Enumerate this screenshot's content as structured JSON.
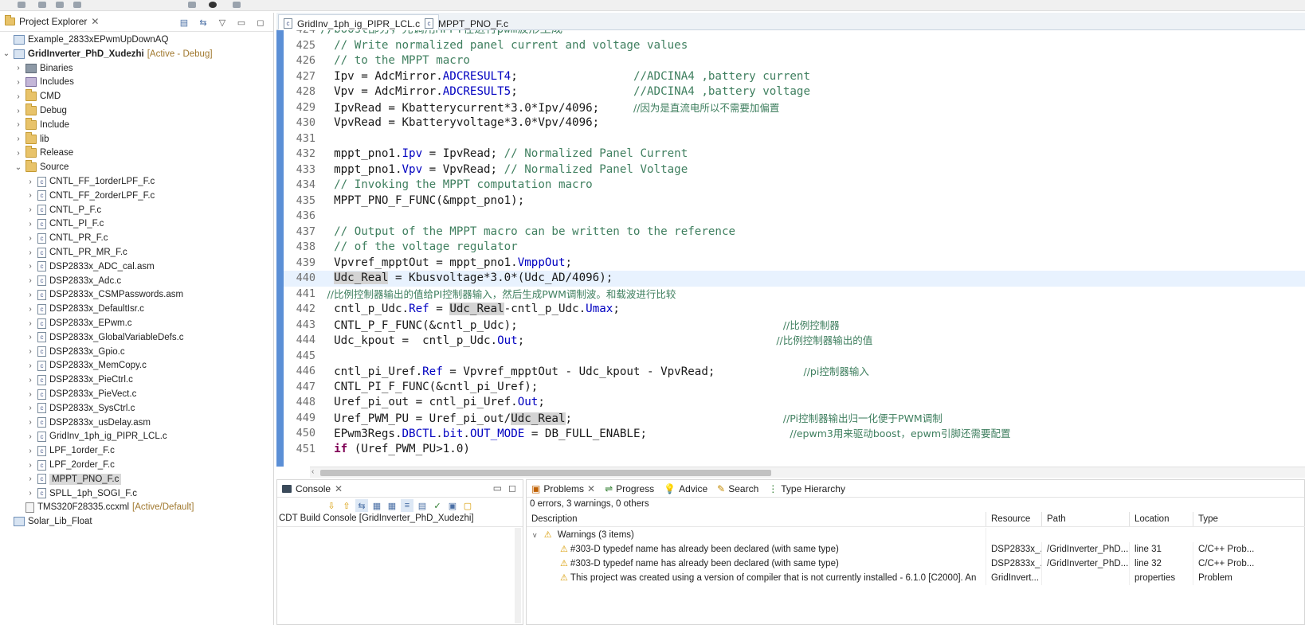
{
  "project_explorer": {
    "tab_label": "Project Explorer",
    "items": [
      {
        "label": "Example_2833xEPwmUpDownAQ",
        "type": "proj",
        "twisty": "",
        "indent": 0
      },
      {
        "label": "GridInverter_PhD_Xudezhi",
        "type": "proj",
        "twisty": "v",
        "indent": 0,
        "bold": true,
        "decoration": "[Active - Debug]"
      },
      {
        "label": "Binaries",
        "type": "bin",
        "twisty": ">",
        "indent": 1
      },
      {
        "label": "Includes",
        "type": "inc",
        "twisty": ">",
        "indent": 1
      },
      {
        "label": "CMD",
        "type": "folder",
        "twisty": ">",
        "indent": 1
      },
      {
        "label": "Debug",
        "type": "folder",
        "twisty": ">",
        "indent": 1
      },
      {
        "label": "Include",
        "type": "folder",
        "twisty": ">",
        "indent": 1
      },
      {
        "label": "lib",
        "type": "folder",
        "twisty": ">",
        "indent": 1
      },
      {
        "label": "Release",
        "type": "folder",
        "twisty": ">",
        "indent": 1
      },
      {
        "label": "Source",
        "type": "folder",
        "twisty": "v",
        "indent": 1
      },
      {
        "label": "CNTL_FF_1orderLPF_F.c",
        "type": "cfile",
        "twisty": ">",
        "indent": 2
      },
      {
        "label": "CNTL_FF_2orderLPF_F.c",
        "type": "cfile",
        "twisty": ">",
        "indent": 2
      },
      {
        "label": "CNTL_P_F.c",
        "type": "cfile",
        "twisty": ">",
        "indent": 2
      },
      {
        "label": "CNTL_PI_F.c",
        "type": "cfile",
        "twisty": ">",
        "indent": 2
      },
      {
        "label": "CNTL_PR_F.c",
        "type": "cfile",
        "twisty": ">",
        "indent": 2
      },
      {
        "label": "CNTL_PR_MR_F.c",
        "type": "cfile",
        "twisty": ">",
        "indent": 2
      },
      {
        "label": "DSP2833x_ADC_cal.asm",
        "type": "cfile",
        "twisty": ">",
        "indent": 2
      },
      {
        "label": "DSP2833x_Adc.c",
        "type": "cfile",
        "twisty": ">",
        "indent": 2
      },
      {
        "label": "DSP2833x_CSMPasswords.asm",
        "type": "cfile",
        "twisty": ">",
        "indent": 2
      },
      {
        "label": "DSP2833x_DefaultIsr.c",
        "type": "cfile",
        "twisty": ">",
        "indent": 2
      },
      {
        "label": "DSP2833x_EPwm.c",
        "type": "cfile",
        "twisty": ">",
        "indent": 2
      },
      {
        "label": "DSP2833x_GlobalVariableDefs.c",
        "type": "cfile",
        "twisty": ">",
        "indent": 2
      },
      {
        "label": "DSP2833x_Gpio.c",
        "type": "cfile",
        "twisty": ">",
        "indent": 2
      },
      {
        "label": "DSP2833x_MemCopy.c",
        "type": "cfile",
        "twisty": ">",
        "indent": 2
      },
      {
        "label": "DSP2833x_PieCtrl.c",
        "type": "cfile",
        "twisty": ">",
        "indent": 2
      },
      {
        "label": "DSP2833x_PieVect.c",
        "type": "cfile",
        "twisty": ">",
        "indent": 2
      },
      {
        "label": "DSP2833x_SysCtrl.c",
        "type": "cfile",
        "twisty": ">",
        "indent": 2
      },
      {
        "label": "DSP2833x_usDelay.asm",
        "type": "cfile",
        "twisty": ">",
        "indent": 2
      },
      {
        "label": "GridInv_1ph_ig_PIPR_LCL.c",
        "type": "cfile",
        "twisty": ">",
        "indent": 2
      },
      {
        "label": "LPF_1order_F.c",
        "type": "cfile",
        "twisty": ">",
        "indent": 2
      },
      {
        "label": "LPF_2order_F.c",
        "type": "cfile",
        "twisty": ">",
        "indent": 2
      },
      {
        "label": "MPPT_PNO_F.c",
        "type": "cfile",
        "twisty": ">",
        "indent": 2,
        "selected": true
      },
      {
        "label": "SPLL_1ph_SOGI_F.c",
        "type": "cfile",
        "twisty": ">",
        "indent": 2
      },
      {
        "label": "TMS320F28335.ccxml",
        "type": "xml",
        "twisty": "",
        "indent": 1,
        "decoration": "[Active/Default]"
      },
      {
        "label": "Solar_Lib_Float",
        "type": "proj",
        "twisty": "",
        "indent": 0
      }
    ]
  },
  "editor": {
    "tabs": [
      {
        "label": "GridInv_1ph_ig_PIPR_LCL.c",
        "active": true
      },
      {
        "label": "MPPT_PNO_F.c",
        "active": false
      }
    ],
    "lines": [
      {
        "n": "424",
        "segs": [
          [
            "cm",
            "//boost部分，先调用MPPT在进行pwm波形生成"
          ]
        ],
        "indent": "",
        "partial": true
      },
      {
        "n": "425",
        "segs": [
          [
            "cm",
            "// Write normalized panel current and voltage values"
          ]
        ],
        "indent": "  "
      },
      {
        "n": "426",
        "segs": [
          [
            "cm",
            "// to the MPPT macro"
          ]
        ],
        "indent": "  "
      },
      {
        "n": "427",
        "segs": [
          [
            "",
            "Ipv = AdcMirror."
          ],
          [
            "fld",
            "ADCRESULT4"
          ],
          [
            "",
            ";                 "
          ],
          [
            "cm",
            "//ADCINA4 ,battery current"
          ]
        ],
        "indent": "  "
      },
      {
        "n": "428",
        "segs": [
          [
            "",
            "Vpv = AdcMirror."
          ],
          [
            "fld",
            "ADCRESULT5"
          ],
          [
            "",
            ";                 "
          ],
          [
            "cm",
            "//ADCINA4 ,battery voltage"
          ]
        ],
        "indent": "  "
      },
      {
        "n": "429",
        "segs": [
          [
            "",
            "IpvRead = Kbatterycurrent*3.0*Ipv/4096;     "
          ],
          [
            "cmcn",
            "//因为是直流电所以不需要加偏置"
          ]
        ],
        "indent": "  "
      },
      {
        "n": "430",
        "segs": [
          [
            "",
            "VpvRead = Kbatteryvoltage*3.0*Vpv/4096;"
          ]
        ],
        "indent": "  "
      },
      {
        "n": "431",
        "segs": [],
        "indent": ""
      },
      {
        "n": "432",
        "segs": [
          [
            "",
            "mppt_pno1."
          ],
          [
            "fld",
            "Ipv"
          ],
          [
            "",
            " = IpvRead; "
          ],
          [
            "cm",
            "// Normalized Panel Current"
          ]
        ],
        "indent": "  "
      },
      {
        "n": "433",
        "segs": [
          [
            "",
            "mppt_pno1."
          ],
          [
            "fld",
            "Vpv"
          ],
          [
            "",
            " = VpvRead; "
          ],
          [
            "cm",
            "// Normalized Panel Voltage"
          ]
        ],
        "indent": "  "
      },
      {
        "n": "434",
        "segs": [
          [
            "cm",
            "// Invoking the MPPT computation macro"
          ]
        ],
        "indent": "  "
      },
      {
        "n": "435",
        "segs": [
          [
            "",
            "MPPT_PNO_F_FUNC(&mppt_pno1);"
          ]
        ],
        "indent": "  "
      },
      {
        "n": "436",
        "segs": [],
        "indent": ""
      },
      {
        "n": "437",
        "segs": [
          [
            "cm",
            "// Output of the MPPT macro can be written to the reference"
          ]
        ],
        "indent": "  "
      },
      {
        "n": "438",
        "segs": [
          [
            "cm",
            "// of the voltage regulator"
          ]
        ],
        "indent": "  "
      },
      {
        "n": "439",
        "segs": [
          [
            "",
            "Vpvref_mpptOut = mppt_pno1."
          ],
          [
            "fld",
            "VmppOut"
          ],
          [
            "",
            ";"
          ]
        ],
        "indent": "  "
      },
      {
        "n": "440",
        "segs": [
          [
            "mk",
            "Udc_Real"
          ],
          [
            "",
            " = Kbusvoltage*3.0*(Udc_AD/4096);"
          ]
        ],
        "indent": "  ",
        "highlight": true
      },
      {
        "n": "441",
        "segs": [
          [
            "cmcn",
            "//比例控制器输出的值给PI控制器输入，然后生成PWM调制波。和载波进行比较"
          ]
        ],
        "indent": " "
      },
      {
        "n": "442",
        "segs": [
          [
            "",
            "cntl_p_Udc."
          ],
          [
            "fld",
            "Ref"
          ],
          [
            "",
            " = "
          ],
          [
            "mk",
            "Udc_Real"
          ],
          [
            "",
            "-cntl_p_Udc."
          ],
          [
            "fld",
            "Umax"
          ],
          [
            "",
            ";"
          ]
        ],
        "indent": "  "
      },
      {
        "n": "443",
        "segs": [
          [
            "",
            "CNTL_P_F_FUNC(&cntl_p_Udc);                                       "
          ],
          [
            "cmcn",
            "//比例控制器"
          ]
        ],
        "indent": "  "
      },
      {
        "n": "444",
        "segs": [
          [
            "",
            "Udc_kpout =  cntl_p_Udc."
          ],
          [
            "fld",
            "Out"
          ],
          [
            "",
            ";                                     "
          ],
          [
            "cmcn",
            "//比例控制器输出的值"
          ]
        ],
        "indent": "  "
      },
      {
        "n": "445",
        "segs": [],
        "indent": ""
      },
      {
        "n": "446",
        "segs": [
          [
            "",
            "cntl_pi_Uref."
          ],
          [
            "fld",
            "Ref"
          ],
          [
            "",
            " = Vpvref_mpptOut - Udc_kpout - VpvRead;             "
          ],
          [
            "cmcn",
            "//pi控制器输入"
          ]
        ],
        "indent": "  "
      },
      {
        "n": "447",
        "segs": [
          [
            "",
            "CNTL_PI_F_FUNC(&cntl_pi_Uref);"
          ]
        ],
        "indent": "  "
      },
      {
        "n": "448",
        "segs": [
          [
            "",
            "Uref_pi_out = cntl_pi_Uref."
          ],
          [
            "fld",
            "Out"
          ],
          [
            "",
            ";"
          ]
        ],
        "indent": "  "
      },
      {
        "n": "449",
        "segs": [
          [
            "",
            "Uref_PWM_PU = Uref_pi_out/"
          ],
          [
            "mk",
            "Udc_Real"
          ],
          [
            "",
            ";                               "
          ],
          [
            "cmcn",
            "//Pi控制器输出归一化便于PWM调制"
          ]
        ],
        "indent": "  "
      },
      {
        "n": "450",
        "segs": [
          [
            "",
            "EPwm3Regs."
          ],
          [
            "fld",
            "DBCTL"
          ],
          [
            "",
            "."
          ],
          [
            "fld",
            "bit"
          ],
          [
            "",
            "."
          ],
          [
            "fld",
            "OUT_MODE"
          ],
          [
            "",
            " = DB_FULL_ENABLE;                     "
          ],
          [
            "cmcn",
            "//epwm3用来驱动boost，epwm引脚还需要配置"
          ]
        ],
        "indent": "  "
      },
      {
        "n": "451",
        "segs": [
          [
            "kw",
            "if"
          ],
          [
            "",
            " (Uref_PWM_PU>1.0)"
          ]
        ],
        "indent": "  "
      }
    ]
  },
  "console": {
    "tab_label": "Console",
    "title": "CDT Build Console [GridInverter_PhD_Xudezhi]"
  },
  "problems": {
    "tabs": [
      "Problems",
      "Progress",
      "Advice",
      "Search",
      "Type Hierarchy"
    ],
    "summary": "0 errors, 3 warnings, 0 others",
    "columns": [
      "Description",
      "Resource",
      "Path",
      "Location",
      "Type"
    ],
    "group": "Warnings (3 items)",
    "rows": [
      {
        "description": "#303-D typedef name has already been declared (with same type)",
        "resource": "DSP2833x_...",
        "path": "/GridInverter_PhD...",
        "location": "line 31",
        "type": "C/C++ Prob..."
      },
      {
        "description": "#303-D typedef name has already been declared (with same type)",
        "resource": "DSP2833x_...",
        "path": "/GridInverter_PhD...",
        "location": "line 32",
        "type": "C/C++ Prob..."
      },
      {
        "description": "This project was created using a version of compiler that is not currently installed - 6.1.0 [C2000]. An",
        "resource": "GridInvert...",
        "path": "",
        "location": "properties",
        "type": "Problem"
      }
    ]
  },
  "colors": {
    "comment": "#3f7f5f",
    "field": "#0000c0",
    "keyword": "#7f0055",
    "warning": "#d89b00",
    "active_decoration": "#a0782e"
  }
}
